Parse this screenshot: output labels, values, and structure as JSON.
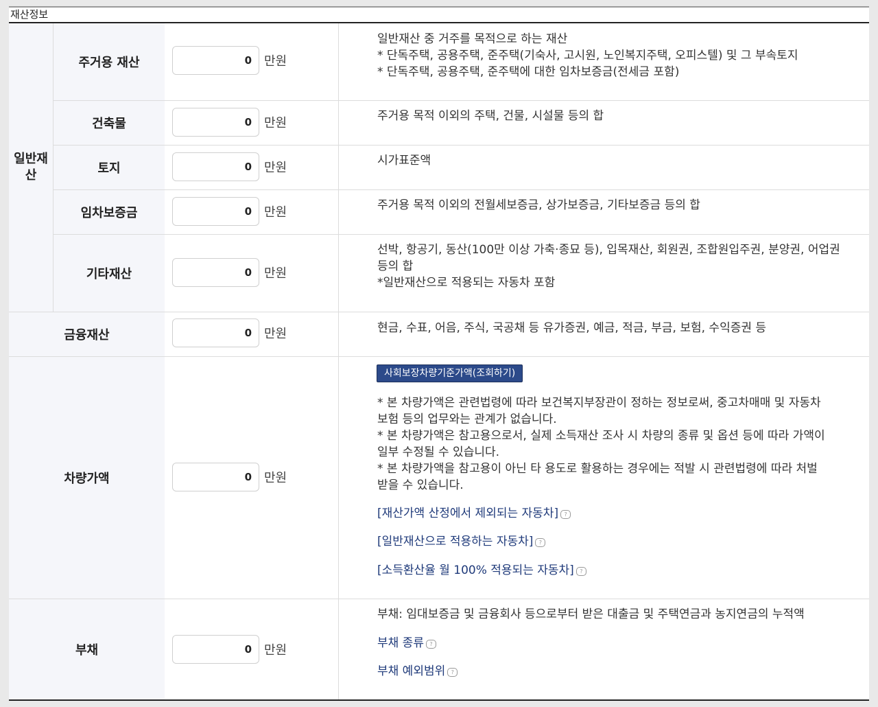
{
  "section_title": "재산정보",
  "unit_label": "만원",
  "general_group_label": "일반재산",
  "rows": [
    {
      "label": "주거용 재산",
      "value": "0",
      "desc": [
        "일반재산 중 거주를 목적으로 하는 재산",
        "* 단독주택, 공용주택, 준주택(기숙사, 고시원, 노인복지주택, 오피스텔) 및 그 부속토지",
        "* 단독주택, 공용주택, 준주택에 대한 임차보증금(전세금 포함)"
      ]
    },
    {
      "label": "건축물",
      "value": "0",
      "desc": [
        "주거용 목적 이외의 주택, 건물, 시설물 등의 합"
      ]
    },
    {
      "label": "토지",
      "value": "0",
      "desc": [
        "시가표준액"
      ]
    },
    {
      "label": "임차보증금",
      "value": "0",
      "desc": [
        "주거용 목적 이외의 전월세보증금, 상가보증금, 기타보증금 등의 합"
      ]
    },
    {
      "label": "기타재산",
      "value": "0",
      "desc": [
        "선박, 항공기, 동산(100만 이상 가축·종묘 등), 입목재산, 회원권, 조합원입주권, 분양권, 어업권",
        "등의 합",
        "*일반재산으로 적용되는 자동차 포함"
      ]
    },
    {
      "label": "금융재산",
      "value": "0",
      "desc": [
        "현금, 수표, 어음, 주식, 국공채 등 유가증권, 예금, 적금, 부금, 보험, 수익증권 등"
      ]
    },
    {
      "label": "차량가액",
      "value": "0",
      "button": "사회보장차량기준가액(조회하기)",
      "desc": [
        "* 본 차량가액은 관련법령에 따라 보건복지부장관이 정하는 정보로써, 중고차매매 및 자동차",
        "보험 등의 업무와는 관계가 없습니다.",
        "* 본 차량가액은 참고용으로서, 실제 소득재산 조사 시 차량의 종류 및 옵션 등에 따라 가액이",
        "일부 수정될 수 있습니다.",
        "* 본 차량가액을 참고용이 아닌 타 용도로 활용하는 경우에는 적발 시 관련법령에 따라 처벌",
        "받을 수 있습니다."
      ],
      "links": [
        "[재산가액 산정에서 제외되는 자동차]",
        "[일반재산으로 적용하는 자동차]",
        "[소득환산율 월 100% 적용되는 자동차]"
      ]
    },
    {
      "label": "부채",
      "value": "0",
      "desc": [
        "부채: 임대보증금 및 금융회사 등으로부터 받은 대출금 및 주택연금과 농지연금의 누적액"
      ],
      "links": [
        "부채 종류",
        "부채 예외범위"
      ]
    }
  ],
  "help_icon": "speech-bubble-icon"
}
